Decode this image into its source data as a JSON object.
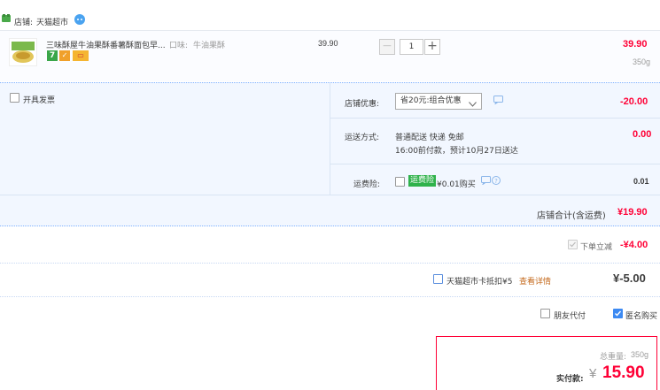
{
  "store": {
    "label": "店铺:",
    "name": "天猫超市"
  },
  "product": {
    "title": "三味酥屋牛油果酥番薯酥面包早...",
    "spec_label": "口味:",
    "spec_value": "牛油果酥",
    "unit_price": "39.90",
    "quantity": "1",
    "minus": "−",
    "plus": "+",
    "total": "39.90",
    "weight": "350g",
    "badges": [
      "7",
      "✓",
      "▭"
    ]
  },
  "invoice": {
    "label": "开具发票"
  },
  "discount": {
    "label": "店铺优惠:",
    "selected": "省20元:组合优惠",
    "amount": "-20.00"
  },
  "shipping": {
    "label": "运送方式:",
    "method": "普通配送 快递 免邮",
    "note": "16:00前付款，预计10月27日送达",
    "amount": "0.00"
  },
  "insurance": {
    "label": "运费险:",
    "badge": "运费险",
    "text": "¥0.01购买",
    "amount": "0.01"
  },
  "store_total": {
    "label": "店铺合计(含运费)",
    "amount": "¥19.90"
  },
  "instant_discount": {
    "label": "下单立减",
    "amount": "-¥4.00"
  },
  "card_coupon": {
    "label": "天猫超市卡抵扣¥5",
    "link": "查看详情",
    "amount": "¥-5.00"
  },
  "friend_pay": {
    "label": "朋友代付"
  },
  "anonymous": {
    "label": "匿名购买"
  },
  "summary": {
    "weight_label": "总重量:",
    "weight": "350g",
    "pay_label": "实付款:",
    "currency": "¥",
    "amount": "15.90"
  },
  "colors": {
    "accent": "#ff0036",
    "link": "#3d8af2",
    "panel": "#f2f7ff",
    "insurance_badge": "#2fb24b",
    "coupon_link": "#c46a1d"
  }
}
